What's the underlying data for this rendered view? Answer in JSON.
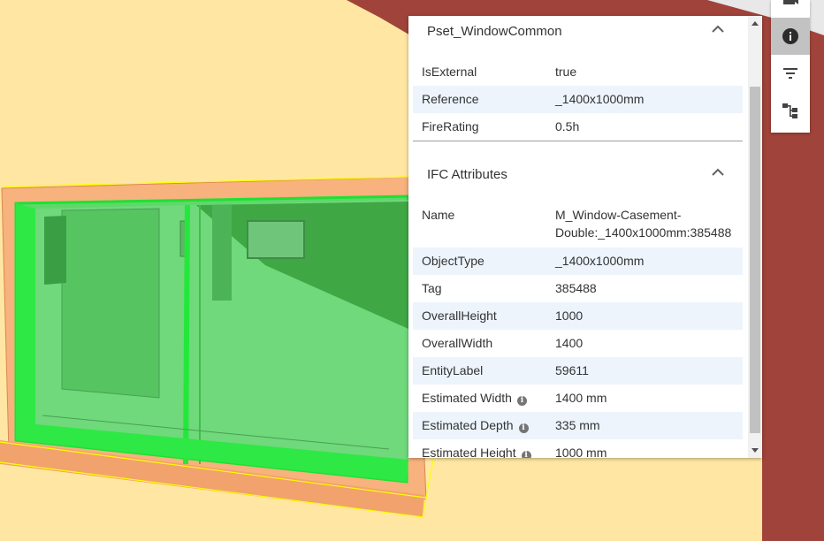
{
  "properties_panel": {
    "sections": [
      {
        "title": "Pset_WindowCommon",
        "expanded": true,
        "rows": [
          {
            "key": "IsExternal",
            "value": "true"
          },
          {
            "key": "Reference",
            "value": "_1400x1000mm"
          },
          {
            "key": "FireRating",
            "value": "0.5h"
          }
        ]
      },
      {
        "title": "IFC Attributes",
        "expanded": true,
        "rows": [
          {
            "key": "Name",
            "value": "M_Window-Casement-Double:_1400x1000mm:385488"
          },
          {
            "key": "ObjectType",
            "value": "_1400x1000mm"
          },
          {
            "key": "Tag",
            "value": "385488"
          },
          {
            "key": "OverallHeight",
            "value": "1000"
          },
          {
            "key": "OverallWidth",
            "value": "1400"
          },
          {
            "key": "EntityLabel",
            "value": "59611"
          },
          {
            "key": "Estimated Width",
            "value": "1400 mm",
            "info": true
          },
          {
            "key": "Estimated Depth",
            "value": "335 mm",
            "info": true
          },
          {
            "key": "Estimated Height",
            "value": "1000 mm",
            "info": true
          }
        ]
      }
    ],
    "info_glyph": "i"
  },
  "toolbar": {
    "buttons": [
      {
        "name": "camera-icon",
        "active": false
      },
      {
        "name": "info-icon",
        "active": true,
        "glyph": "i"
      },
      {
        "name": "filter-icon",
        "active": false
      },
      {
        "name": "tree-icon",
        "active": false
      }
    ]
  },
  "colors": {
    "background": "#ffe7a3",
    "wall": "#a0433a",
    "selection": "#2fe84a",
    "accent_row": "#edf4fc"
  }
}
